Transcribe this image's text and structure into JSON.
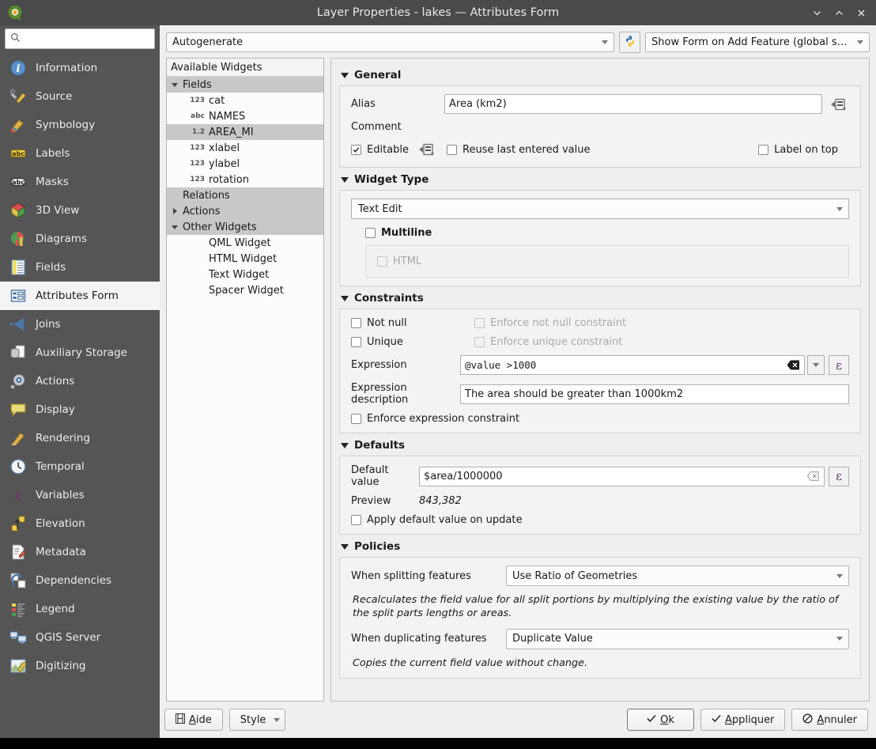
{
  "window": {
    "title": "Layer Properties - lakes — Attributes Form",
    "logo_icon": "qgis-logo-icon",
    "minimize_label": "⌄",
    "maximize_label": "⌃",
    "close_label": "✕"
  },
  "sidebar": {
    "search": {
      "value": "",
      "placeholder": "",
      "icon": "search-icon"
    },
    "items": [
      {
        "label": "Information",
        "icon": "information-icon",
        "selected": false
      },
      {
        "label": "Source",
        "icon": "source-icon",
        "selected": false
      },
      {
        "label": "Symbology",
        "icon": "symbology-icon",
        "selected": false
      },
      {
        "label": "Labels",
        "icon": "labels-icon",
        "selected": false
      },
      {
        "label": "Masks",
        "icon": "masks-icon",
        "selected": false
      },
      {
        "label": "3D View",
        "icon": "3d-view-icon",
        "selected": false
      },
      {
        "label": "Diagrams",
        "icon": "diagrams-icon",
        "selected": false
      },
      {
        "label": "Fields",
        "icon": "fields-icon",
        "selected": false
      },
      {
        "label": "Attributes Form",
        "icon": "attributes-form-icon",
        "selected": true
      },
      {
        "label": "Joins",
        "icon": "joins-icon",
        "selected": false
      },
      {
        "label": "Auxiliary Storage",
        "icon": "auxiliary-storage-icon",
        "selected": false
      },
      {
        "label": "Actions",
        "icon": "actions-icon",
        "selected": false
      },
      {
        "label": "Display",
        "icon": "display-icon",
        "selected": false
      },
      {
        "label": "Rendering",
        "icon": "rendering-icon",
        "selected": false
      },
      {
        "label": "Temporal",
        "icon": "temporal-icon",
        "selected": false
      },
      {
        "label": "Variables",
        "icon": "variables-icon",
        "selected": false
      },
      {
        "label": "Elevation",
        "icon": "elevation-icon",
        "selected": false
      },
      {
        "label": "Metadata",
        "icon": "metadata-icon",
        "selected": false
      },
      {
        "label": "Dependencies",
        "icon": "dependencies-icon",
        "selected": false
      },
      {
        "label": "Legend",
        "icon": "legend-icon",
        "selected": false
      },
      {
        "label": "QGIS Server",
        "icon": "qgis-server-icon",
        "selected": false
      },
      {
        "label": "Digitizing",
        "icon": "digitizing-icon",
        "selected": false
      }
    ]
  },
  "topbar": {
    "layout_combo": {
      "value": "Autogenerate",
      "icon": "chevron-down-icon"
    },
    "python_button": {
      "icon": "python-icon",
      "tooltip": "Python Init Code"
    },
    "form_suppress_combo": {
      "value": "Show Form on Add Feature (global settings)",
      "icon": "chevron-down-icon"
    }
  },
  "widgets_tree": {
    "header": "Available Widgets",
    "nodes": [
      {
        "label": "Fields",
        "depth": 0,
        "twisty": "down",
        "icon": "",
        "style": "group"
      },
      {
        "label": "cat",
        "depth": 1,
        "twisty": "",
        "icon": "123",
        "style": "leaf"
      },
      {
        "label": "NAMES",
        "depth": 1,
        "twisty": "",
        "icon": "abc",
        "style": "leaf"
      },
      {
        "label": "AREA_MI",
        "depth": 1,
        "twisty": "",
        "icon": "1.2",
        "style": "selected"
      },
      {
        "label": "xlabel",
        "depth": 1,
        "twisty": "",
        "icon": "123",
        "style": "leaf"
      },
      {
        "label": "ylabel",
        "depth": 1,
        "twisty": "",
        "icon": "123",
        "style": "leaf"
      },
      {
        "label": "rotation",
        "depth": 1,
        "twisty": "",
        "icon": "123",
        "style": "leaf"
      },
      {
        "label": "Relations",
        "depth": 0,
        "twisty": "",
        "icon": "",
        "style": "group"
      },
      {
        "label": "Actions",
        "depth": 0,
        "twisty": "right",
        "icon": "",
        "style": "group"
      },
      {
        "label": "Other Widgets",
        "depth": 0,
        "twisty": "down",
        "icon": "",
        "style": "group"
      },
      {
        "label": "QML Widget",
        "depth": 1,
        "twisty": "",
        "icon": "",
        "style": "leaf"
      },
      {
        "label": "HTML Widget",
        "depth": 1,
        "twisty": "",
        "icon": "",
        "style": "leaf"
      },
      {
        "label": "Text Widget",
        "depth": 1,
        "twisty": "",
        "icon": "",
        "style": "leaf"
      },
      {
        "label": "Spacer Widget",
        "depth": 1,
        "twisty": "",
        "icon": "",
        "style": "leaf"
      }
    ]
  },
  "general": {
    "title": "General",
    "alias_label": "Alias",
    "alias_value": "Area (km2)",
    "alias_override_icon": "data-defined-override-icon",
    "comment_label": "Comment",
    "editable_label": "Editable",
    "editable_checked": true,
    "editable_override_icon": "data-defined-override-icon",
    "reuse_label": "Reuse last entered value",
    "reuse_checked": false,
    "label_on_top_label": "Label on top",
    "label_on_top_checked": false
  },
  "widget_type": {
    "title": "Widget Type",
    "selected": "Text Edit",
    "multiline_label": "Multiline",
    "multiline_checked": false,
    "html_label": "HTML",
    "html_checked": false,
    "html_disabled": true
  },
  "constraints": {
    "title": "Constraints",
    "not_null_label": "Not null",
    "not_null_checked": false,
    "enforce_not_null_label": "Enforce not null constraint",
    "enforce_not_null_checked": false,
    "enforce_not_null_disabled": true,
    "unique_label": "Unique",
    "unique_checked": false,
    "enforce_unique_label": "Enforce unique constraint",
    "enforce_unique_checked": false,
    "enforce_unique_disabled": true,
    "expression_label": "Expression",
    "expression_value": "@value >1000",
    "expression_clear_icon": "clear-icon",
    "expression_dropdown_icon": "chevron-down-icon",
    "expression_builder_icon": "epsilon-expression-icon",
    "expression_builder_glyph": "ε",
    "expr_desc_label": "Expression description",
    "expr_desc_value": "The area should be greater than 1000km2",
    "enforce_expression_label": "Enforce expression constraint",
    "enforce_expression_checked": false
  },
  "defaults": {
    "title": "Defaults",
    "default_value_label": "Default value",
    "default_value": "$area/1000000",
    "default_clear_icon": "clear-icon",
    "default_builder_glyph": "ε",
    "preview_label": "Preview",
    "preview_value": "843,382",
    "apply_on_update_label": "Apply default value on update",
    "apply_on_update_checked": false
  },
  "policies": {
    "title": "Policies",
    "split_label": "When splitting features",
    "split_value": "Use Ratio of Geometries",
    "split_hint": "Recalculates the field value for all split portions by multiplying the existing value by the ratio of the split parts lengths or areas.",
    "duplicate_label": "When duplicating features",
    "duplicate_value": "Duplicate Value",
    "duplicate_hint": "Copies the current field value without change."
  },
  "buttons": {
    "help": "Aide",
    "help_icon": "help-icon",
    "style": "Style",
    "style_arrow_icon": "chevron-down-icon",
    "ok": "Ok",
    "ok_icon": "check-icon",
    "apply": "Appliquer",
    "apply_icon": "check-icon",
    "cancel": "Annuler",
    "cancel_icon": "cancel-icon"
  },
  "colors": {
    "titlebar": "#4a4a4a",
    "sidebar": "#555555",
    "sidebar_selected": "#f4f4f4",
    "panel_bg": "#efefef",
    "group_bg": "#f3f3f3",
    "field_bg": "#ffffff",
    "tree_group": "#c8c8c8",
    "expression_accent": "#6b2d6b"
  }
}
